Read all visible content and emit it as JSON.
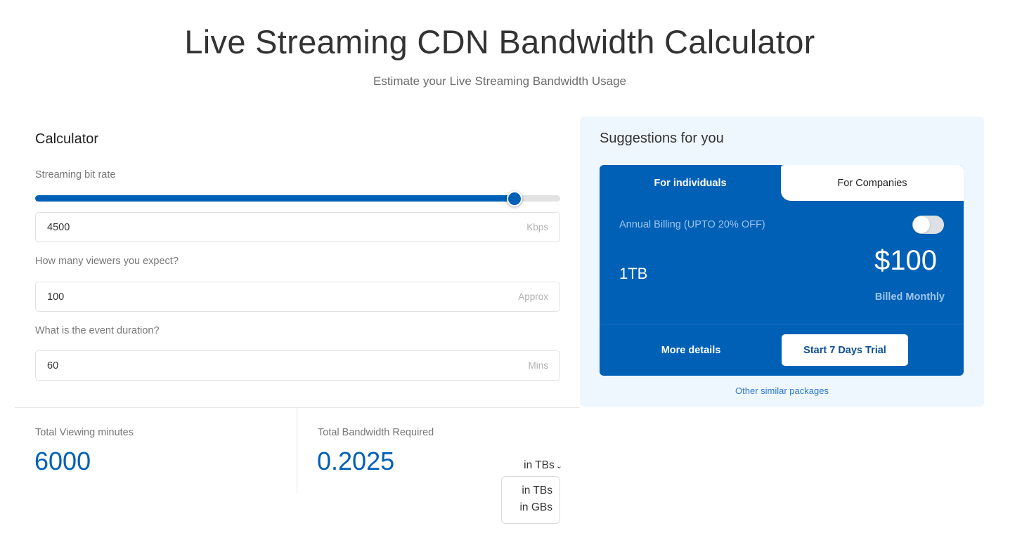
{
  "header": {
    "title": "Live Streaming CDN Bandwidth Calculator",
    "subtitle": "Estimate your Live Streaming Bandwidth Usage"
  },
  "calculator": {
    "title": "Calculator",
    "bitrate": {
      "label": "Streaming bit rate",
      "value": "4500",
      "suffix": "Kbps",
      "slider_fraction": 0.913
    },
    "viewers": {
      "label": "How many viewers you expect?",
      "value": "100",
      "suffix": "Approx"
    },
    "duration": {
      "label": "What is the event duration?",
      "value": "60",
      "suffix": "Mins"
    }
  },
  "results": {
    "viewing_minutes": {
      "label": "Total Viewing minutes",
      "value": "6000"
    },
    "bandwidth": {
      "label": "Total Bandwidth Required",
      "value": "0.2025",
      "unit_selected": "in TBs",
      "unit_options": [
        "in TBs",
        "in GBs"
      ]
    }
  },
  "suggestions": {
    "title": "Suggestions for you",
    "tabs": [
      {
        "label": "For individuals",
        "active": true
      },
      {
        "label": "For Companies",
        "active": false
      }
    ],
    "billing_label": "Annual Billing (UPTO 20% OFF)",
    "annual_billing_on": false,
    "plan_size": "1TB",
    "plan_price": "$100",
    "billed_text": "Billed Monthly",
    "more_details_label": "More details",
    "trial_label": "Start 7 Days Trial",
    "other_link": "Other similar packages"
  },
  "colors": {
    "accent": "#0060b6",
    "panel_bg": "#eef6fe",
    "muted_text": "#777777"
  }
}
